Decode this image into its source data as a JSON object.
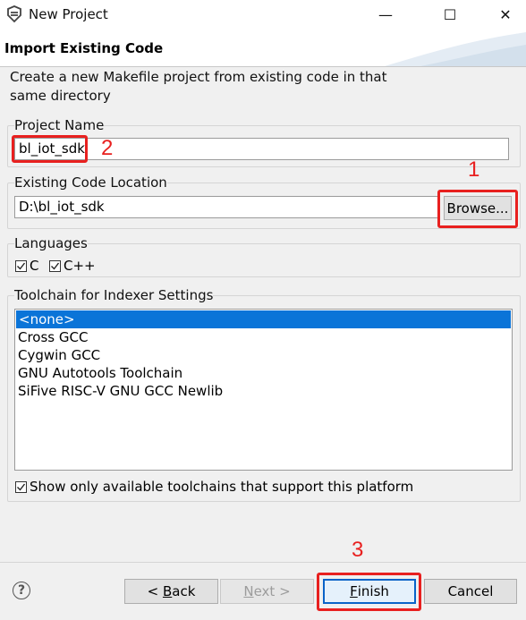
{
  "window": {
    "title": "New Project",
    "minimize_glyph": "—",
    "maximize_glyph": "☐",
    "close_glyph": "✕"
  },
  "header": {
    "title": "Import Existing Code",
    "description": "Create a new Makefile project from existing code in that same directory"
  },
  "project_name": {
    "label": "Project Name",
    "value": "bl_iot_sdk"
  },
  "code_location": {
    "label": "Existing Code Location",
    "value": "D:\\bl_iot_sdk",
    "browse_label": "Browse..."
  },
  "languages": {
    "label": "Languages",
    "items": [
      {
        "label": "C",
        "checked": true
      },
      {
        "label": "C++",
        "checked": true
      }
    ]
  },
  "toolchain": {
    "label": "Toolchain for Indexer Settings",
    "items": [
      "<none>",
      "Cross GCC",
      "Cygwin GCC",
      "GNU Autotools Toolchain",
      "SiFive RISC-V GNU GCC Newlib"
    ],
    "selected_index": 0,
    "show_only_available_label": "Show only available toolchains that support this platform",
    "show_only_available_checked": true
  },
  "buttons": {
    "back_prefix": "< ",
    "back_mnemonic": "B",
    "back_rest": "ack",
    "next_prefix": "",
    "next_mnemonic": "N",
    "next_rest": "ext >",
    "finish_mnemonic": "F",
    "finish_rest": "inish",
    "cancel": "Cancel"
  },
  "help": {
    "glyph": "?"
  },
  "annotations": {
    "step1": "1",
    "step2": "2",
    "step3": "3",
    "color": "#e8201f"
  },
  "colors": {
    "selection": "#0a74d8",
    "default_button_border": "#0a64c8"
  }
}
